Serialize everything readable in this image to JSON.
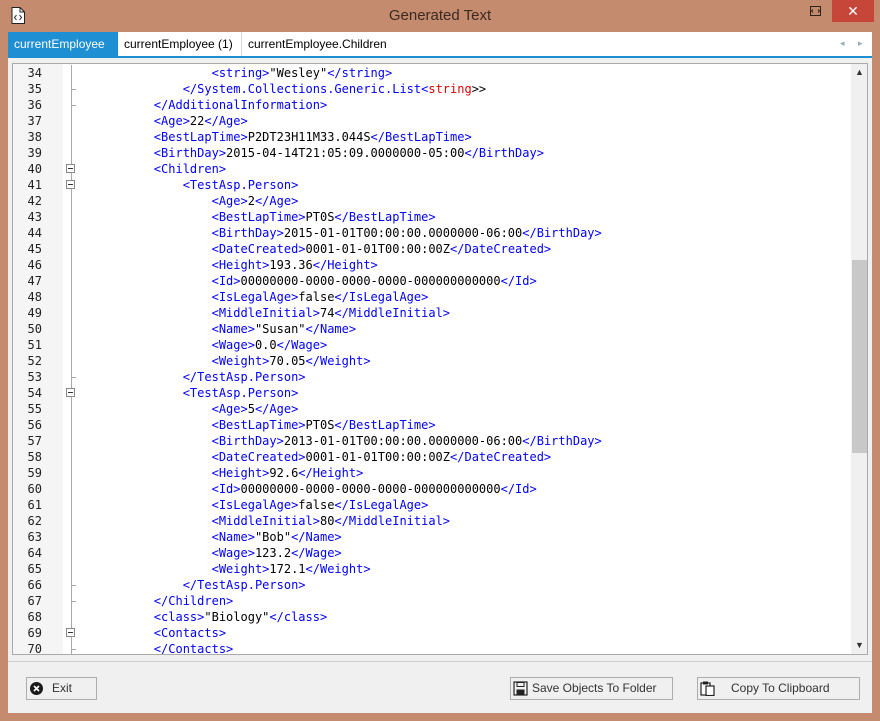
{
  "window": {
    "title": "Generated Text",
    "close_glyph": "✕"
  },
  "icons": [
    "document-code-icon",
    "restore-icon",
    "close-icon",
    "exit-icon",
    "save-icon",
    "clipboard-icon"
  ],
  "tabs": [
    {
      "label": "currentEmployee",
      "active": true
    },
    {
      "label": "currentEmployee (1)",
      "active": false
    },
    {
      "label": "currentEmployee.Children",
      "active": false
    }
  ],
  "tab_nav": {
    "left": "◂",
    "right": "▸"
  },
  "editor": {
    "lines": [
      {
        "n": "34",
        "fold": "line",
        "indent": 16,
        "parts": [
          [
            "t",
            "<string>"
          ],
          [
            "v",
            "\"Wesley\""
          ],
          [
            "t",
            "</string>"
          ]
        ]
      },
      {
        "n": "35",
        "fold": "end",
        "indent": 12,
        "parts": [
          [
            "t",
            "</System.Collections.Generic.List<"
          ],
          [
            "r",
            "string"
          ],
          [
            "v",
            ">>"
          ]
        ]
      },
      {
        "n": "36",
        "fold": "end",
        "indent": 8,
        "parts": [
          [
            "t",
            "</AdditionalInformation>"
          ]
        ]
      },
      {
        "n": "37",
        "fold": "line",
        "indent": 8,
        "parts": [
          [
            "t",
            "<Age>"
          ],
          [
            "v",
            "22"
          ],
          [
            "t",
            "</Age>"
          ]
        ]
      },
      {
        "n": "38",
        "fold": "line",
        "indent": 8,
        "parts": [
          [
            "t",
            "<BestLapTime>"
          ],
          [
            "v",
            "P2DT23H11M33.044S"
          ],
          [
            "t",
            "</BestLapTime>"
          ]
        ]
      },
      {
        "n": "39",
        "fold": "line",
        "indent": 8,
        "parts": [
          [
            "t",
            "<BirthDay>"
          ],
          [
            "v",
            "2015-04-14T21:05:09.0000000-05:00"
          ],
          [
            "t",
            "</BirthDay>"
          ]
        ]
      },
      {
        "n": "40",
        "fold": "box",
        "indent": 8,
        "parts": [
          [
            "t",
            "<Children>"
          ]
        ]
      },
      {
        "n": "41",
        "fold": "box",
        "indent": 12,
        "parts": [
          [
            "t",
            "<TestAsp.Person>"
          ]
        ]
      },
      {
        "n": "42",
        "fold": "line",
        "indent": 16,
        "parts": [
          [
            "t",
            "<Age>"
          ],
          [
            "v",
            "2"
          ],
          [
            "t",
            "</Age>"
          ]
        ]
      },
      {
        "n": "43",
        "fold": "line",
        "indent": 16,
        "parts": [
          [
            "t",
            "<BestLapTime>"
          ],
          [
            "v",
            "PT0S"
          ],
          [
            "t",
            "</BestLapTime>"
          ]
        ]
      },
      {
        "n": "44",
        "fold": "line",
        "indent": 16,
        "parts": [
          [
            "t",
            "<BirthDay>"
          ],
          [
            "v",
            "2015-01-01T00:00:00.0000000-06:00"
          ],
          [
            "t",
            "</BirthDay>"
          ]
        ]
      },
      {
        "n": "45",
        "fold": "line",
        "indent": 16,
        "parts": [
          [
            "t",
            "<DateCreated>"
          ],
          [
            "v",
            "0001-01-01T00:00:00Z"
          ],
          [
            "t",
            "</DateCreated>"
          ]
        ]
      },
      {
        "n": "46",
        "fold": "line",
        "indent": 16,
        "parts": [
          [
            "t",
            "<Height>"
          ],
          [
            "v",
            "193.36"
          ],
          [
            "t",
            "</Height>"
          ]
        ]
      },
      {
        "n": "47",
        "fold": "line",
        "indent": 16,
        "parts": [
          [
            "t",
            "<Id>"
          ],
          [
            "v",
            "00000000-0000-0000-0000-000000000000"
          ],
          [
            "t",
            "</Id>"
          ]
        ]
      },
      {
        "n": "48",
        "fold": "line",
        "indent": 16,
        "parts": [
          [
            "t",
            "<IsLegalAge>"
          ],
          [
            "v",
            "false"
          ],
          [
            "t",
            "</IsLegalAge>"
          ]
        ]
      },
      {
        "n": "49",
        "fold": "line",
        "indent": 16,
        "parts": [
          [
            "t",
            "<MiddleInitial>"
          ],
          [
            "v",
            "74"
          ],
          [
            "t",
            "</MiddleInitial>"
          ]
        ]
      },
      {
        "n": "50",
        "fold": "line",
        "indent": 16,
        "parts": [
          [
            "t",
            "<Name>"
          ],
          [
            "v",
            "\"Susan\""
          ],
          [
            "t",
            "</Name>"
          ]
        ]
      },
      {
        "n": "51",
        "fold": "line",
        "indent": 16,
        "parts": [
          [
            "t",
            "<Wage>"
          ],
          [
            "v",
            "0.0"
          ],
          [
            "t",
            "</Wage>"
          ]
        ]
      },
      {
        "n": "52",
        "fold": "line",
        "indent": 16,
        "parts": [
          [
            "t",
            "<Weight>"
          ],
          [
            "v",
            "70.05"
          ],
          [
            "t",
            "</Weight>"
          ]
        ]
      },
      {
        "n": "53",
        "fold": "end",
        "indent": 12,
        "parts": [
          [
            "t",
            "</TestAsp.Person>"
          ]
        ]
      },
      {
        "n": "54",
        "fold": "box",
        "indent": 12,
        "parts": [
          [
            "t",
            "<TestAsp.Person>"
          ]
        ]
      },
      {
        "n": "55",
        "fold": "line",
        "indent": 16,
        "parts": [
          [
            "t",
            "<Age>"
          ],
          [
            "v",
            "5"
          ],
          [
            "t",
            "</Age>"
          ]
        ]
      },
      {
        "n": "56",
        "fold": "line",
        "indent": 16,
        "parts": [
          [
            "t",
            "<BestLapTime>"
          ],
          [
            "v",
            "PT0S"
          ],
          [
            "t",
            "</BestLapTime>"
          ]
        ]
      },
      {
        "n": "57",
        "fold": "line",
        "indent": 16,
        "parts": [
          [
            "t",
            "<BirthDay>"
          ],
          [
            "v",
            "2013-01-01T00:00:00.0000000-06:00"
          ],
          [
            "t",
            "</BirthDay>"
          ]
        ]
      },
      {
        "n": "58",
        "fold": "line",
        "indent": 16,
        "parts": [
          [
            "t",
            "<DateCreated>"
          ],
          [
            "v",
            "0001-01-01T00:00:00Z"
          ],
          [
            "t",
            "</DateCreated>"
          ]
        ]
      },
      {
        "n": "59",
        "fold": "line",
        "indent": 16,
        "parts": [
          [
            "t",
            "<Height>"
          ],
          [
            "v",
            "92.6"
          ],
          [
            "t",
            "</Height>"
          ]
        ]
      },
      {
        "n": "60",
        "fold": "line",
        "indent": 16,
        "parts": [
          [
            "t",
            "<Id>"
          ],
          [
            "v",
            "00000000-0000-0000-0000-000000000000"
          ],
          [
            "t",
            "</Id>"
          ]
        ]
      },
      {
        "n": "61",
        "fold": "line",
        "indent": 16,
        "parts": [
          [
            "t",
            "<IsLegalAge>"
          ],
          [
            "v",
            "false"
          ],
          [
            "t",
            "</IsLegalAge>"
          ]
        ]
      },
      {
        "n": "62",
        "fold": "line",
        "indent": 16,
        "parts": [
          [
            "t",
            "<MiddleInitial>"
          ],
          [
            "v",
            "80"
          ],
          [
            "t",
            "</MiddleInitial>"
          ]
        ]
      },
      {
        "n": "63",
        "fold": "line",
        "indent": 16,
        "parts": [
          [
            "t",
            "<Name>"
          ],
          [
            "v",
            "\"Bob\""
          ],
          [
            "t",
            "</Name>"
          ]
        ]
      },
      {
        "n": "64",
        "fold": "line",
        "indent": 16,
        "parts": [
          [
            "t",
            "<Wage>"
          ],
          [
            "v",
            "123.2"
          ],
          [
            "t",
            "</Wage>"
          ]
        ]
      },
      {
        "n": "65",
        "fold": "line",
        "indent": 16,
        "parts": [
          [
            "t",
            "<Weight>"
          ],
          [
            "v",
            "172.1"
          ],
          [
            "t",
            "</Weight>"
          ]
        ]
      },
      {
        "n": "66",
        "fold": "end",
        "indent": 12,
        "parts": [
          [
            "t",
            "</TestAsp.Person>"
          ]
        ]
      },
      {
        "n": "67",
        "fold": "end",
        "indent": 8,
        "parts": [
          [
            "t",
            "</Children>"
          ]
        ]
      },
      {
        "n": "68",
        "fold": "line",
        "indent": 8,
        "parts": [
          [
            "t",
            "<class>"
          ],
          [
            "v",
            "\"Biology\""
          ],
          [
            "t",
            "</class>"
          ]
        ]
      },
      {
        "n": "69",
        "fold": "box",
        "indent": 8,
        "parts": [
          [
            "t",
            "<Contacts>"
          ]
        ]
      },
      {
        "n": "70",
        "fold": "end",
        "indent": 8,
        "parts": [
          [
            "t",
            "</Contacts>"
          ]
        ]
      }
    ]
  },
  "scrollbar": {
    "up": "▲",
    "down": "▼"
  },
  "buttons": {
    "exit": "Exit",
    "save": "Save Objects To Folder",
    "copy": "Copy To Clipboard"
  }
}
